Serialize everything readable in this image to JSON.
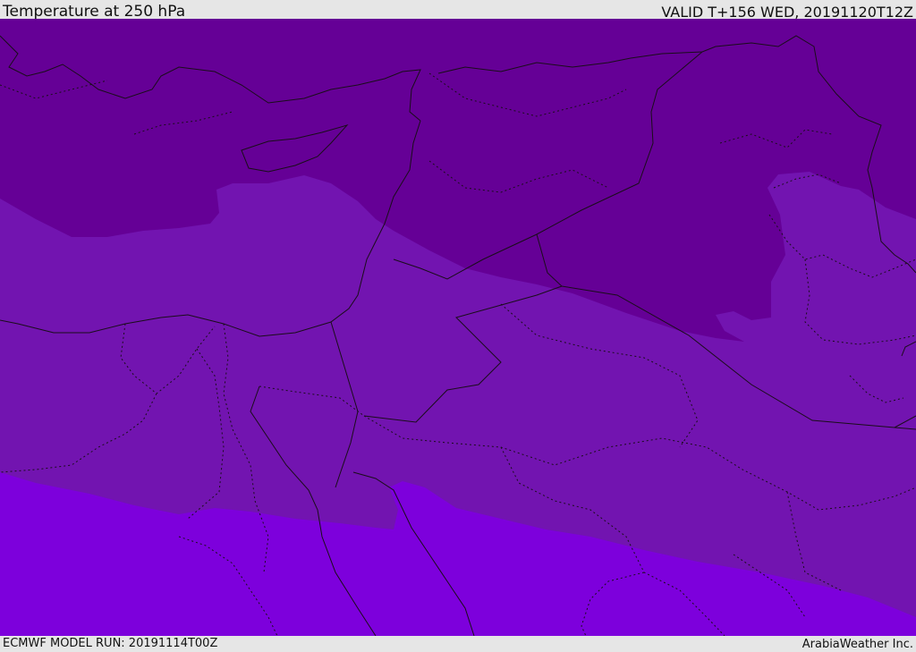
{
  "header": {
    "title": "Temperature at 250 hPa",
    "valid": "VALID T+156 WED, 20191120T12Z"
  },
  "footer": {
    "model_run": "ECMWF MODEL RUN: 20191114T00Z",
    "credit": "ArabiaWeather Inc."
  },
  "colors": {
    "band_coldest": "#650096",
    "band_mid": "#7214b0",
    "band_warm": "#7d00dc",
    "boundaries": "#1a0d1a"
  }
}
